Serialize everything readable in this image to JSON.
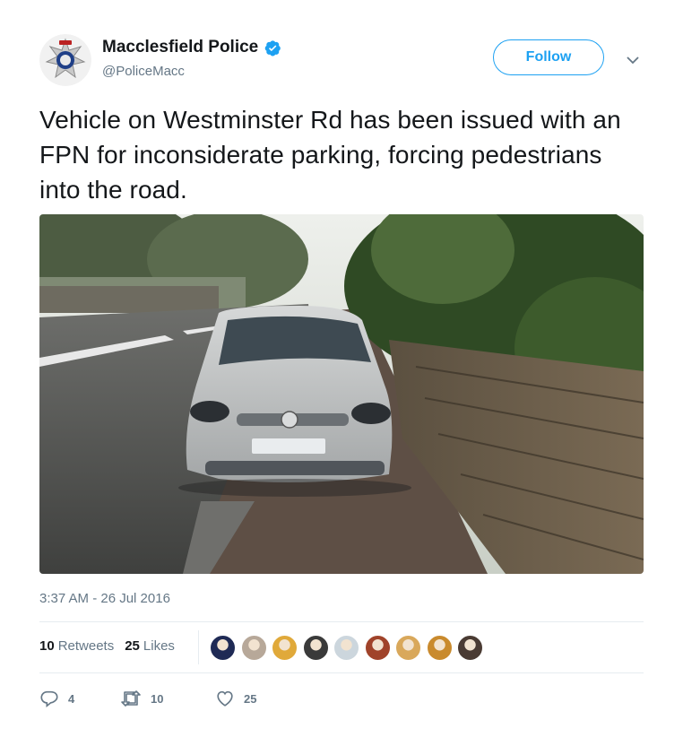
{
  "user": {
    "name": "Macclesfield Police",
    "handle": "@PoliceMacc"
  },
  "follow_label": "Follow",
  "tweet_text": "Vehicle on Westminster Rd has been issued with an FPN for inconsiderate parking, forcing pedestrians into the road.",
  "timestamp": "3:37 AM - 26 Jul 2016",
  "stats": {
    "retweets_count": "10",
    "retweets_label": "Retweets",
    "likes_count": "25",
    "likes_label": "Likes"
  },
  "likers": [
    {
      "name": "liker-1-avatar",
      "color": "#1f2a55"
    },
    {
      "name": "liker-2-avatar",
      "color": "#b7a899"
    },
    {
      "name": "liker-3-avatar",
      "color": "#e0a93a"
    },
    {
      "name": "liker-4-avatar",
      "color": "#3a3a3a"
    },
    {
      "name": "liker-5-avatar",
      "color": "#ccd6dd"
    },
    {
      "name": "liker-6-avatar",
      "color": "#a0432a"
    },
    {
      "name": "liker-7-avatar",
      "color": "#d9a85b"
    },
    {
      "name": "liker-8-avatar",
      "color": "#c98a2d"
    },
    {
      "name": "liker-9-avatar",
      "color": "#4a3b33"
    }
  ],
  "actions": {
    "reply_count": "4",
    "retweet_count": "10",
    "like_count": "25"
  },
  "colors": {
    "accent": "#1da1f2",
    "text": "#14171a",
    "secondary": "#657786",
    "divider": "#e6ecf0"
  }
}
